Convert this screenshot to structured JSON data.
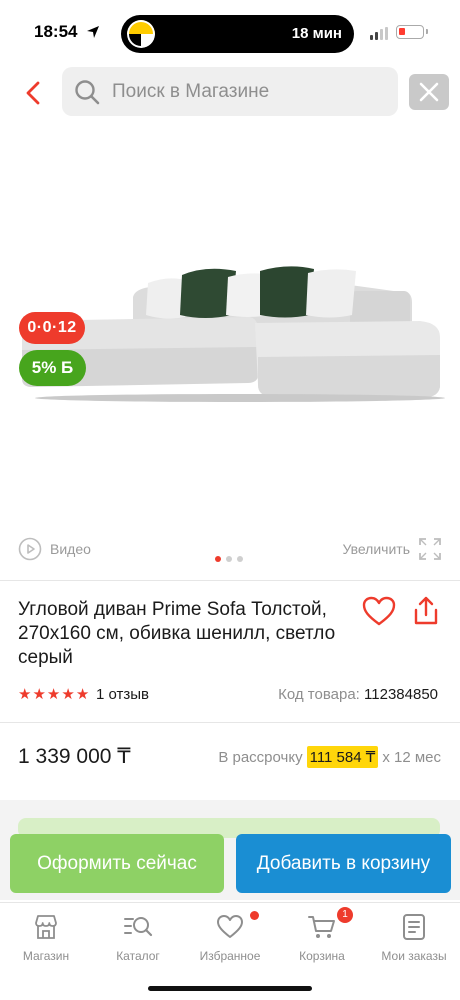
{
  "status_bar": {
    "time": "18:54",
    "ride_eta": "18 мин"
  },
  "search": {
    "placeholder": "Поиск в Магазине"
  },
  "gallery": {
    "timer_badge": "0·0·12",
    "bonus_badge": "5% Б",
    "video_label": "Видео",
    "zoom_label": "Увеличить",
    "slide_count": 3,
    "active_slide": 1
  },
  "product": {
    "title": "Угловой диван Prime Sofa Толстой, 270x160 см, обивка шенилл, светло серый",
    "rating": 5,
    "reviews": "1 отзыв",
    "code_label": "Код товара:",
    "code": "112384850",
    "price": "1 339 000 ₸",
    "installment_label": "В рассрочку",
    "installment_amount": "111 584 ₸",
    "installment_term": "x 12 мес"
  },
  "actions": {
    "buy_now": "Оформить сейчас",
    "add_to_cart": "Добавить в корзину"
  },
  "tabbar": {
    "items": [
      {
        "label": "Магазин",
        "icon": "shop-icon"
      },
      {
        "label": "Каталог",
        "icon": "catalog-search-icon"
      },
      {
        "label": "Избранное",
        "icon": "heart-icon"
      },
      {
        "label": "Корзина",
        "icon": "cart-icon"
      },
      {
        "label": "Мои заказы",
        "icon": "orders-icon"
      }
    ],
    "cart_count": "1"
  },
  "colors": {
    "accent_red": "#ee3b2c",
    "bonus_green": "#47a51d",
    "buy_green": "#8ed165",
    "cart_blue": "#1a8ed3",
    "installment_yellow": "#ffd60a"
  }
}
